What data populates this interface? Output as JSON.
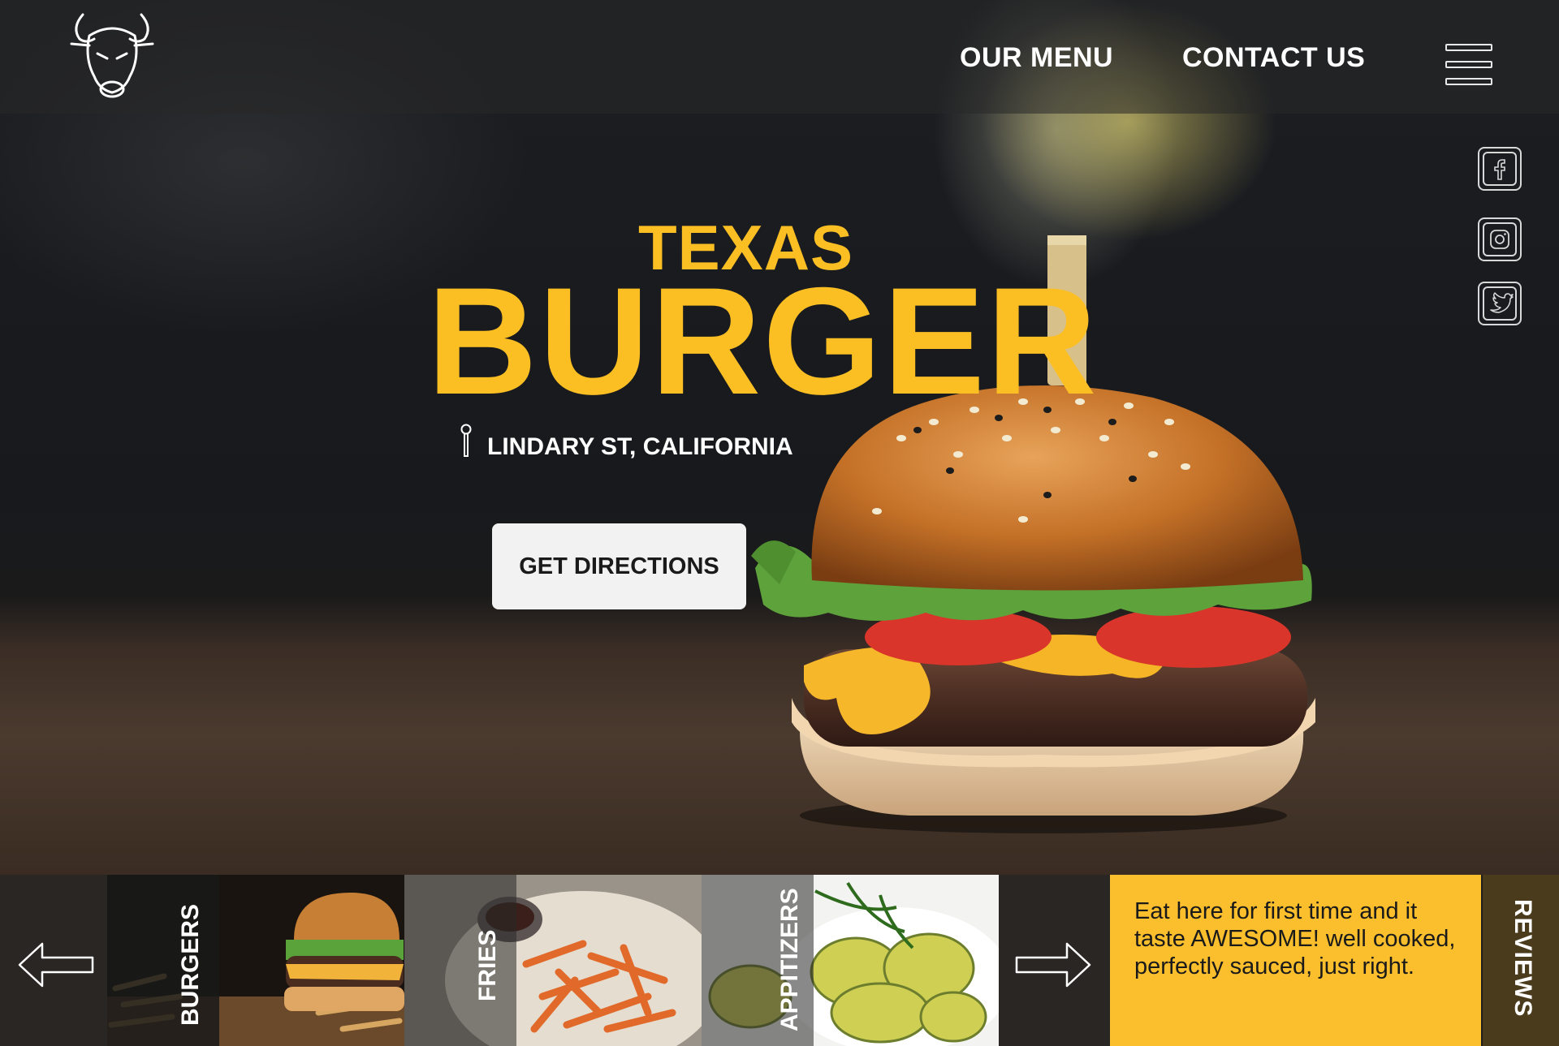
{
  "header": {
    "logo_icon": "bull-head-icon",
    "nav": [
      {
        "label": "OUR MENU"
      },
      {
        "label": "CONTACT US"
      }
    ],
    "menu_icon": "hamburger-menu-icon"
  },
  "social": [
    {
      "icon": "facebook-icon",
      "glyph": "f"
    },
    {
      "icon": "instagram-icon",
      "glyph": "◎"
    },
    {
      "icon": "twitter-icon",
      "glyph": "✈"
    }
  ],
  "hero": {
    "title_small": "TEXAS",
    "title_big": "BURGER",
    "address": "LINDARY ST, CALIFORNIA",
    "pin_icon": "map-pin-icon",
    "cta_label": "GET DIRECTIONS"
  },
  "strip": {
    "prev_icon": "arrow-left-icon",
    "next_icon": "arrow-right-icon",
    "categories": [
      {
        "label": "BURGERS"
      },
      {
        "label": "FRIES"
      },
      {
        "label": "APPITIZERS"
      }
    ],
    "review_text": "Eat here for first time and it taste AWESOME! well cooked, perfectly sauced,  just right.",
    "reviews_label": "REVIEWS"
  },
  "colors": {
    "accent": "#fbbf24",
    "review_bg": "#fbbf2d",
    "reviews_tab": "#4a3b1d"
  }
}
